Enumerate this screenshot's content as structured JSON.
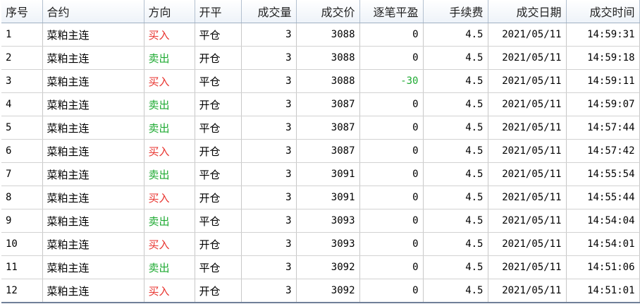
{
  "colors": {
    "buy": "#e8322d",
    "sell": "#1eaa32",
    "negative_pnl": "#1eaa32"
  },
  "columns": [
    "序号",
    "合约",
    "方向",
    "开平",
    "成交量",
    "成交价",
    "逐笔平盈",
    "手续费",
    "成交日期",
    "成交时间"
  ],
  "rows": [
    {
      "no": "1",
      "contract": "菜粕主连",
      "direction": "买入",
      "dir_type": "buy",
      "offset": "平仓",
      "volume": "3",
      "price": "3088",
      "pnl": "0",
      "fee": "4.5",
      "date": "2021/05/11",
      "time": "14:59:31"
    },
    {
      "no": "2",
      "contract": "菜粕主连",
      "direction": "卖出",
      "dir_type": "sell",
      "offset": "开仓",
      "volume": "3",
      "price": "3088",
      "pnl": "0",
      "fee": "4.5",
      "date": "2021/05/11",
      "time": "14:59:18"
    },
    {
      "no": "3",
      "contract": "菜粕主连",
      "direction": "买入",
      "dir_type": "buy",
      "offset": "平仓",
      "volume": "3",
      "price": "3088",
      "pnl": "-30",
      "fee": "4.5",
      "date": "2021/05/11",
      "time": "14:59:11"
    },
    {
      "no": "4",
      "contract": "菜粕主连",
      "direction": "卖出",
      "dir_type": "sell",
      "offset": "开仓",
      "volume": "3",
      "price": "3087",
      "pnl": "0",
      "fee": "4.5",
      "date": "2021/05/11",
      "time": "14:59:07"
    },
    {
      "no": "5",
      "contract": "菜粕主连",
      "direction": "卖出",
      "dir_type": "sell",
      "offset": "平仓",
      "volume": "3",
      "price": "3087",
      "pnl": "0",
      "fee": "4.5",
      "date": "2021/05/11",
      "time": "14:57:44"
    },
    {
      "no": "6",
      "contract": "菜粕主连",
      "direction": "买入",
      "dir_type": "buy",
      "offset": "开仓",
      "volume": "3",
      "price": "3087",
      "pnl": "0",
      "fee": "4.5",
      "date": "2021/05/11",
      "time": "14:57:42"
    },
    {
      "no": "7",
      "contract": "菜粕主连",
      "direction": "卖出",
      "dir_type": "sell",
      "offset": "平仓",
      "volume": "3",
      "price": "3091",
      "pnl": "0",
      "fee": "4.5",
      "date": "2021/05/11",
      "time": "14:55:54"
    },
    {
      "no": "8",
      "contract": "菜粕主连",
      "direction": "买入",
      "dir_type": "buy",
      "offset": "开仓",
      "volume": "3",
      "price": "3091",
      "pnl": "0",
      "fee": "4.5",
      "date": "2021/05/11",
      "time": "14:55:44"
    },
    {
      "no": "9",
      "contract": "菜粕主连",
      "direction": "卖出",
      "dir_type": "sell",
      "offset": "平仓",
      "volume": "3",
      "price": "3093",
      "pnl": "0",
      "fee": "4.5",
      "date": "2021/05/11",
      "time": "14:54:04"
    },
    {
      "no": "10",
      "contract": "菜粕主连",
      "direction": "买入",
      "dir_type": "buy",
      "offset": "开仓",
      "volume": "3",
      "price": "3093",
      "pnl": "0",
      "fee": "4.5",
      "date": "2021/05/11",
      "time": "14:54:01"
    },
    {
      "no": "11",
      "contract": "菜粕主连",
      "direction": "卖出",
      "dir_type": "sell",
      "offset": "平仓",
      "volume": "3",
      "price": "3092",
      "pnl": "0",
      "fee": "4.5",
      "date": "2021/05/11",
      "time": "14:51:06"
    },
    {
      "no": "12",
      "contract": "菜粕主连",
      "direction": "买入",
      "dir_type": "buy",
      "offset": "开仓",
      "volume": "3",
      "price": "3092",
      "pnl": "0",
      "fee": "4.5",
      "date": "2021/05/11",
      "time": "14:51:01"
    }
  ]
}
